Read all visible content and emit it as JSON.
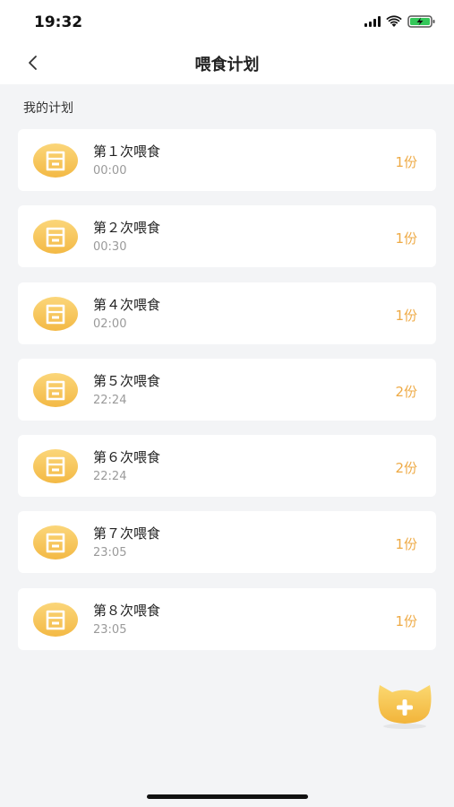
{
  "status_bar": {
    "time": "19:32",
    "icons": [
      "signal-icon",
      "wifi-icon",
      "battery-charging-icon"
    ],
    "battery_color": "#34c759"
  },
  "nav": {
    "title": "喂食计划",
    "back_icon": "chevron-left-icon"
  },
  "section_title": "我的计划",
  "plans": [
    {
      "name": "第１次喂食",
      "time": "00:00",
      "portion": "1份"
    },
    {
      "name": "第２次喂食",
      "time": "00:30",
      "portion": "1份"
    },
    {
      "name": "第４次喂食",
      "time": "02:00",
      "portion": "1份"
    },
    {
      "name": "第５次喂食",
      "time": "22:24",
      "portion": "2份"
    },
    {
      "name": "第６次喂食",
      "time": "22:24",
      "portion": "2份"
    },
    {
      "name": "第７次喂食",
      "time": "23:05",
      "portion": "1份"
    },
    {
      "name": "第８次喂食",
      "time": "23:05",
      "portion": "1份"
    }
  ],
  "colors": {
    "accent": "#eeaa45",
    "icon_gold": "#f5c24a",
    "background": "#f3f4f6"
  },
  "add_button_icon": "cat-add-icon"
}
